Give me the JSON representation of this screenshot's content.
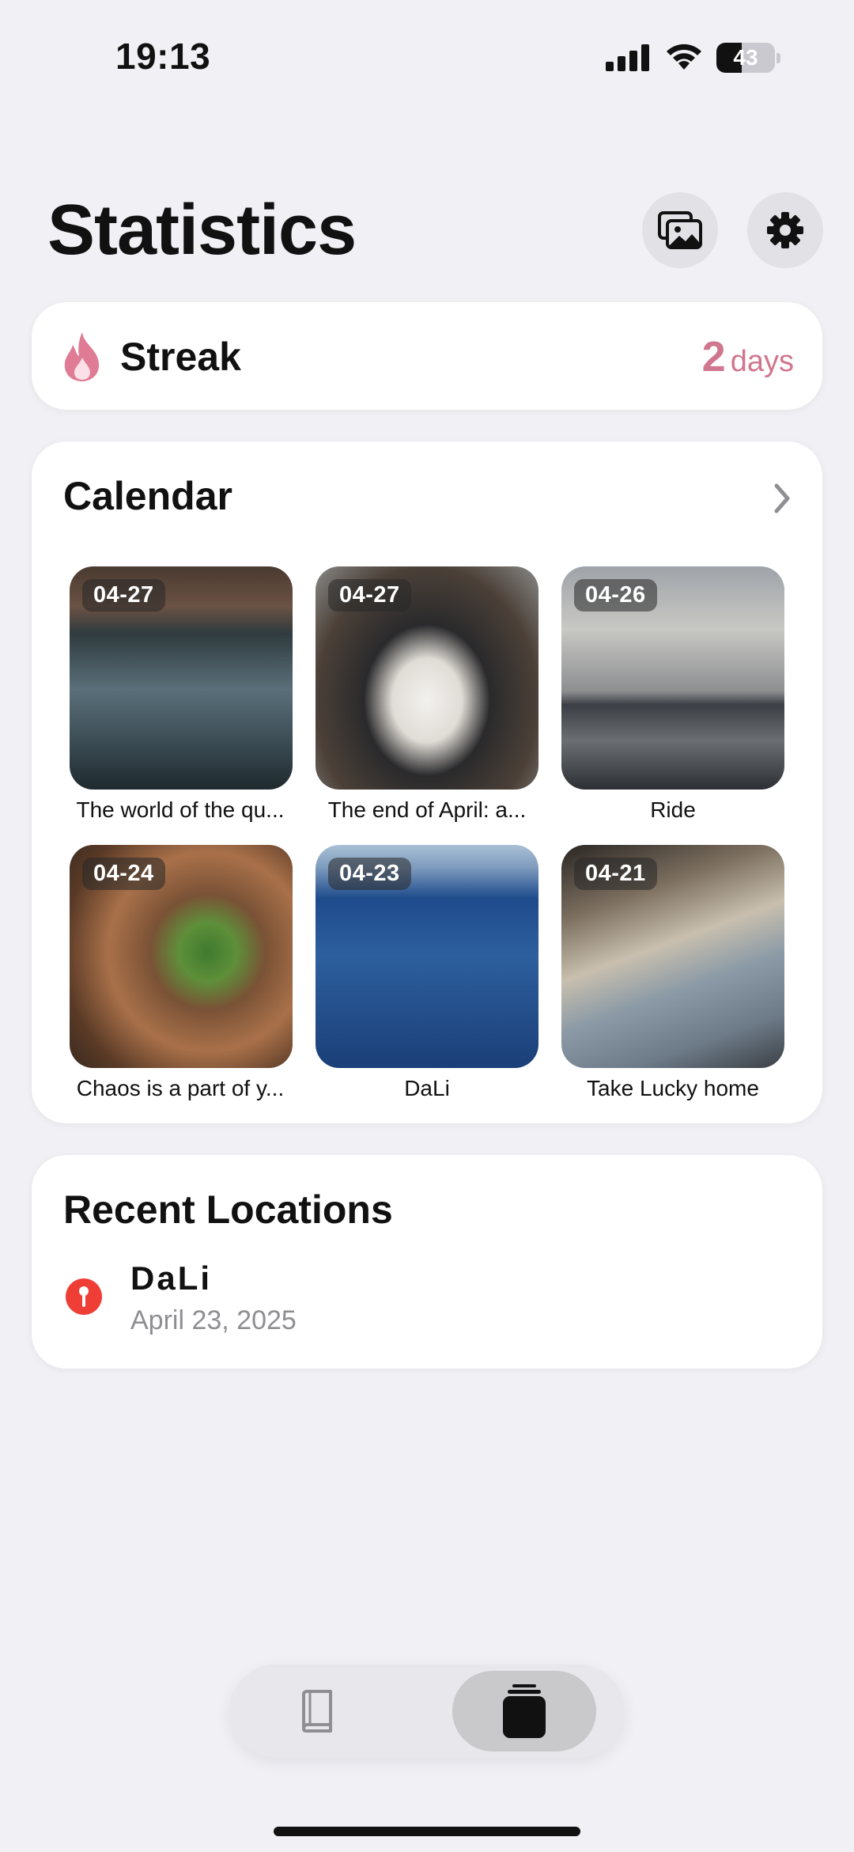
{
  "status_bar": {
    "time": "19:13",
    "battery": "43"
  },
  "header": {
    "title": "Statistics",
    "gallery_icon": "photo-stack-icon",
    "settings_icon": "gear-icon"
  },
  "streak": {
    "icon": "flame-icon",
    "label": "Streak",
    "value": "2",
    "unit": "days",
    "accent": "#d0768f"
  },
  "calendar": {
    "title": "Calendar",
    "entries": [
      {
        "date": "04-27",
        "caption": "The world of the qu..."
      },
      {
        "date": "04-27",
        "caption": "The end of April: a..."
      },
      {
        "date": "04-26",
        "caption": "Ride"
      },
      {
        "date": "04-24",
        "caption": "Chaos is a part of y..."
      },
      {
        "date": "04-23",
        "caption": "DaLi"
      },
      {
        "date": "04-21",
        "caption": "Take Lucky home"
      }
    ]
  },
  "recent_locations": {
    "title": "Recent Locations",
    "items": [
      {
        "name": "DaLi",
        "date": "April 23, 2025",
        "pin_color": "#ef3e36"
      }
    ]
  },
  "tab_bar": {
    "tabs": [
      {
        "icon": "book-icon",
        "selected": false
      },
      {
        "icon": "stack-icon",
        "selected": true
      }
    ]
  }
}
